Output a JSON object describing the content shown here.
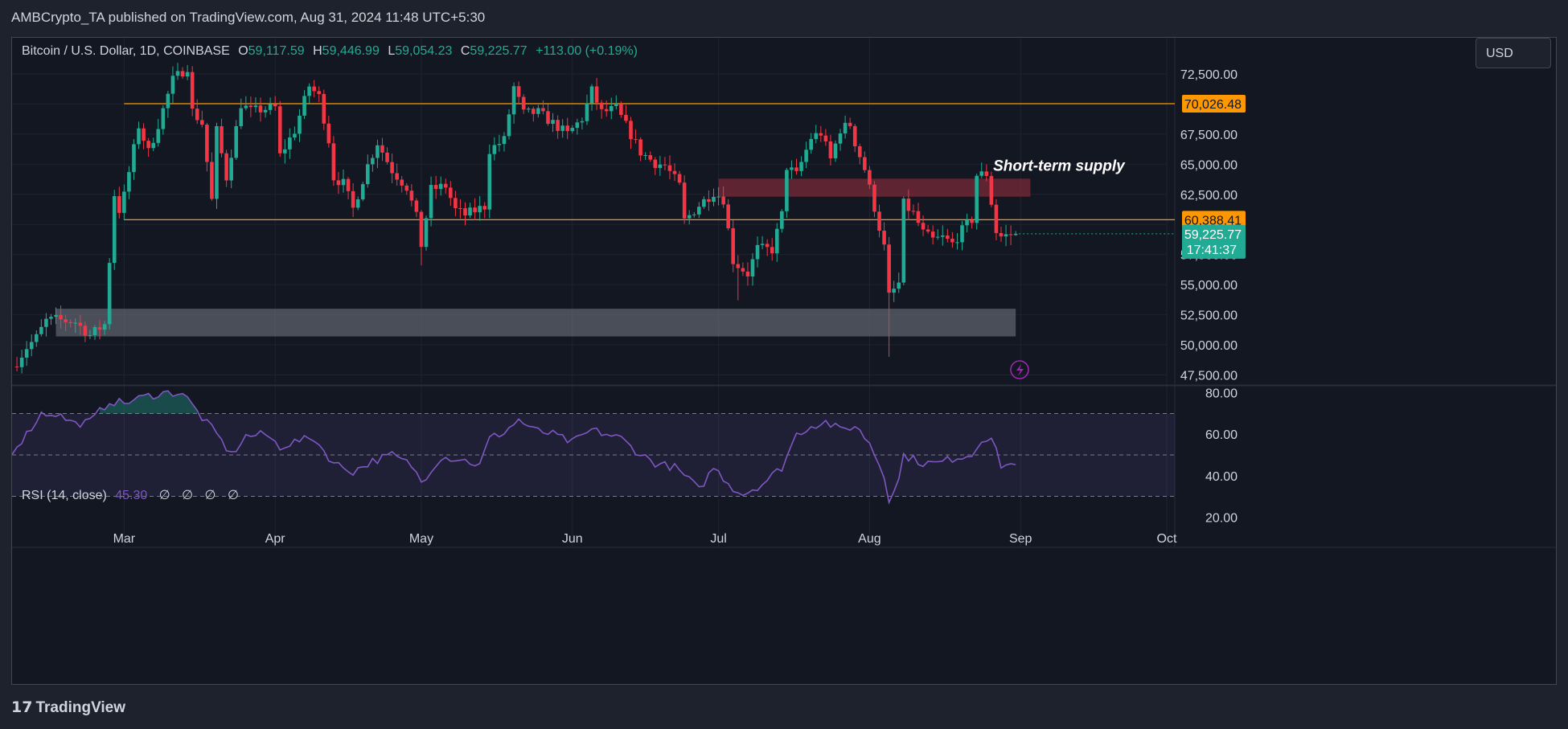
{
  "header": {
    "published": "AMBCrypto_TA published on TradingView.com, Aug 31, 2024 11:48 UTC+5:30"
  },
  "legend": {
    "symbol": "Bitcoin / U.S. Dollar, 1D, COINBASE",
    "open_label": "O",
    "open": "59,117.59",
    "high_label": "H",
    "high": "59,446.99",
    "low_label": "L",
    "low": "59,054.23",
    "close_label": "C",
    "close": "59,225.77",
    "change": "+113.00 (+0.19%)"
  },
  "currency": "USD",
  "rsi_legend": {
    "label": "RSI (14, close)",
    "value": "45.30",
    "extra": [
      "∅",
      "∅",
      "∅",
      "∅"
    ]
  },
  "footer": {
    "brand": "TradingView",
    "logo_glyph": "17"
  },
  "colors": {
    "up": "#22ab94",
    "down": "#f23645",
    "level": "#ff9800",
    "rsi": "#7e57c2",
    "supply": "#7a2a38",
    "demand": "#787b86",
    "bg": "#131722"
  },
  "chart_data": [
    {
      "type": "candlestick",
      "title": "Bitcoin / U.S. Dollar, 1D, COINBASE",
      "x_range": [
        "2024-02-07",
        "2024-10-01"
      ],
      "x_ticks": [
        "Mar",
        "Apr",
        "May",
        "Jun",
        "Jul",
        "Aug",
        "Sep",
        "Oct"
      ],
      "y_ticks": [
        "72,500.00",
        "70,000.00",
        "67,500.00",
        "65,000.00",
        "62,500.00",
        "60,000.00",
        "57,500.00",
        "55,000.00",
        "52,500.00",
        "50,000.00",
        "47,500.00"
      ],
      "ylim": [
        47000,
        75500
      ],
      "grid": true,
      "levels": [
        {
          "value": 70026.48,
          "label": "70,026.48",
          "from": "2024-03-01"
        },
        {
          "value": 60388.41,
          "label": "60,388.41",
          "from": "2024-03-01"
        }
      ],
      "last_price": {
        "value": 59225.77,
        "label": "59,225.77",
        "countdown": "17:41:37"
      },
      "zones": [
        {
          "name": "supply",
          "from": "2024-07-01",
          "to": "2024-09-03",
          "low": 62300,
          "high": 63800
        },
        {
          "name": "demand",
          "from": "2024-02-16",
          "to": "2024-08-31",
          "low": 50700,
          "high": 53000
        }
      ],
      "annotation": {
        "text": "Short-term supply",
        "date": "2024-08-30",
        "value": 65000
      },
      "close_points": [
        [
          "2024-02-08",
          48600
        ],
        [
          "2024-02-10",
          49800
        ],
        [
          "2024-02-12",
          50600
        ],
        [
          "2024-02-14",
          52000
        ],
        [
          "2024-02-16",
          52100
        ],
        [
          "2024-02-20",
          51900
        ],
        [
          "2024-02-23",
          50800
        ],
        [
          "2024-02-26",
          51700
        ],
        [
          "2024-02-27",
          57000
        ],
        [
          "2024-02-28",
          62500
        ],
        [
          "2024-02-29",
          61200
        ],
        [
          "2024-03-01",
          62400
        ],
        [
          "2024-03-04",
          68200
        ],
        [
          "2024-03-06",
          66000
        ],
        [
          "2024-03-08",
          68300
        ],
        [
          "2024-03-11",
          72000
        ],
        [
          "2024-03-14",
          73100
        ],
        [
          "2024-03-15",
          69400
        ],
        [
          "2024-03-17",
          68400
        ],
        [
          "2024-03-19",
          62000
        ],
        [
          "2024-03-20",
          67800
        ],
        [
          "2024-03-22",
          63900
        ],
        [
          "2024-03-25",
          70000
        ],
        [
          "2024-03-27",
          69400
        ],
        [
          "2024-03-30",
          69600
        ],
        [
          "2024-04-01",
          69700
        ],
        [
          "2024-04-02",
          65700
        ],
        [
          "2024-04-05",
          67800
        ],
        [
          "2024-04-08",
          71500
        ],
        [
          "2024-04-10",
          70600
        ],
        [
          "2024-04-12",
          67000
        ],
        [
          "2024-04-13",
          63900
        ],
        [
          "2024-04-15",
          63400
        ],
        [
          "2024-04-17",
          61300
        ],
        [
          "2024-04-20",
          64900
        ],
        [
          "2024-04-22",
          66800
        ],
        [
          "2024-04-25",
          64500
        ],
        [
          "2024-04-28",
          63100
        ],
        [
          "2024-04-30",
          60600
        ],
        [
          "2024-05-01",
          58300
        ],
        [
          "2024-05-03",
          62900
        ],
        [
          "2024-05-06",
          63200
        ],
        [
          "2024-05-08",
          61200
        ],
        [
          "2024-05-10",
          60800
        ],
        [
          "2024-05-14",
          61500
        ],
        [
          "2024-05-15",
          66200
        ],
        [
          "2024-05-18",
          67000
        ],
        [
          "2024-05-20",
          71400
        ],
        [
          "2024-05-22",
          69200
        ],
        [
          "2024-05-25",
          69300
        ],
        [
          "2024-05-28",
          68400
        ],
        [
          "2024-05-31",
          67500
        ],
        [
          "2024-06-03",
          68800
        ],
        [
          "2024-06-05",
          71100
        ],
        [
          "2024-06-07",
          69300
        ],
        [
          "2024-06-10",
          69600
        ],
        [
          "2024-06-12",
          68200
        ],
        [
          "2024-06-15",
          66000
        ],
        [
          "2024-06-18",
          65100
        ],
        [
          "2024-06-20",
          64900
        ],
        [
          "2024-06-23",
          63200
        ],
        [
          "2024-06-24",
          60300
        ],
        [
          "2024-06-27",
          61600
        ],
        [
          "2024-06-30",
          62700
        ],
        [
          "2024-07-02",
          62100
        ],
        [
          "2024-07-04",
          57000
        ],
        [
          "2024-07-05",
          56600
        ],
        [
          "2024-07-07",
          55900
        ],
        [
          "2024-07-09",
          58000
        ],
        [
          "2024-07-12",
          57900
        ],
        [
          "2024-07-14",
          60800
        ],
        [
          "2024-07-15",
          64800
        ],
        [
          "2024-07-17",
          64100
        ],
        [
          "2024-07-20",
          67200
        ],
        [
          "2024-07-22",
          67600
        ],
        [
          "2024-07-24",
          65400
        ],
        [
          "2024-07-26",
          67900
        ],
        [
          "2024-07-28",
          68300
        ],
        [
          "2024-07-29",
          66800
        ],
        [
          "2024-07-31",
          64600
        ],
        [
          "2024-08-02",
          61400
        ],
        [
          "2024-08-04",
          58100
        ],
        [
          "2024-08-05",
          54000
        ],
        [
          "2024-08-07",
          55100
        ],
        [
          "2024-08-08",
          61700
        ],
        [
          "2024-08-10",
          60900
        ],
        [
          "2024-08-12",
          59300
        ],
        [
          "2024-08-14",
          58700
        ],
        [
          "2024-08-16",
          58900
        ],
        [
          "2024-08-18",
          58400
        ],
        [
          "2024-08-20",
          59500
        ],
        [
          "2024-08-22",
          60400
        ],
        [
          "2024-08-23",
          64100
        ],
        [
          "2024-08-25",
          64200
        ],
        [
          "2024-08-27",
          59400
        ],
        [
          "2024-08-28",
          59000
        ],
        [
          "2024-08-31",
          59225.77
        ]
      ],
      "daily_candles": "estimated daily open/high/low/close around the close path above"
    },
    {
      "type": "line",
      "title": "RSI (14, close)",
      "ylim": [
        17,
        83
      ],
      "y_ticks": [
        "80.00",
        "60.00",
        "40.00",
        "20.00"
      ],
      "band": {
        "upper": 70,
        "middle": 50,
        "lower": 30
      },
      "series": [
        {
          "values": [
            [
              "2024-02-07",
              52
            ],
            [
              "2024-02-10",
              60
            ],
            [
              "2024-02-13",
              70
            ],
            [
              "2024-02-16",
              70
            ],
            [
              "2024-02-20",
              65
            ],
            [
              "2024-02-23",
              66
            ],
            [
              "2024-02-27",
              76
            ],
            [
              "2024-03-01",
              75
            ],
            [
              "2024-03-05",
              78
            ],
            [
              "2024-03-09",
              80
            ],
            [
              "2024-03-13",
              80
            ],
            [
              "2024-03-17",
              68
            ],
            [
              "2024-03-20",
              60
            ],
            [
              "2024-03-23",
              50
            ],
            [
              "2024-03-26",
              59
            ],
            [
              "2024-03-30",
              60
            ],
            [
              "2024-04-02",
              54
            ],
            [
              "2024-04-06",
              57
            ],
            [
              "2024-04-09",
              58
            ],
            [
              "2024-04-13",
              46
            ],
            [
              "2024-04-17",
              42
            ],
            [
              "2024-04-21",
              47
            ],
            [
              "2024-04-25",
              50
            ],
            [
              "2024-04-29",
              45
            ],
            [
              "2024-05-01",
              37
            ],
            [
              "2024-05-05",
              49
            ],
            [
              "2024-05-09",
              48
            ],
            [
              "2024-05-13",
              45
            ],
            [
              "2024-05-15",
              58
            ],
            [
              "2024-05-18",
              61
            ],
            [
              "2024-05-21",
              67
            ],
            [
              "2024-05-24",
              62
            ],
            [
              "2024-05-28",
              60
            ],
            [
              "2024-06-01",
              56
            ],
            [
              "2024-06-05",
              62
            ],
            [
              "2024-06-08",
              60
            ],
            [
              "2024-06-11",
              58
            ],
            [
              "2024-06-14",
              52
            ],
            [
              "2024-06-18",
              46
            ],
            [
              "2024-06-22",
              44
            ],
            [
              "2024-06-25",
              38
            ],
            [
              "2024-06-27",
              33
            ],
            [
              "2024-06-30",
              44
            ],
            [
              "2024-07-04",
              34
            ],
            [
              "2024-07-06",
              31
            ],
            [
              "2024-07-10",
              36
            ],
            [
              "2024-07-14",
              44
            ],
            [
              "2024-07-17",
              60
            ],
            [
              "2024-07-20",
              64
            ],
            [
              "2024-07-23",
              66
            ],
            [
              "2024-07-26",
              62
            ],
            [
              "2024-07-29",
              64
            ],
            [
              "2024-08-01",
              56
            ],
            [
              "2024-08-04",
              40
            ],
            [
              "2024-08-05",
              29
            ],
            [
              "2024-08-07",
              38
            ],
            [
              "2024-08-08",
              50
            ],
            [
              "2024-08-12",
              46
            ],
            [
              "2024-08-15",
              46
            ],
            [
              "2024-08-19",
              49
            ],
            [
              "2024-08-22",
              50
            ],
            [
              "2024-08-24",
              58
            ],
            [
              "2024-08-26",
              58
            ],
            [
              "2024-08-28",
              45
            ],
            [
              "2024-08-31",
              45.3
            ]
          ]
        }
      ]
    }
  ]
}
